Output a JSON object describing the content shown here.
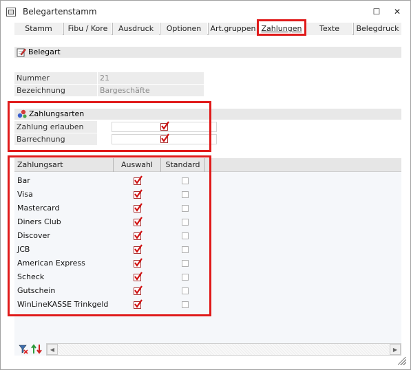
{
  "window": {
    "title": "Belegartenstamm"
  },
  "tabs": [
    {
      "label": "Stamm",
      "active": false
    },
    {
      "label": "Fibu / Kore",
      "active": false
    },
    {
      "label": "Ausdruck",
      "active": false
    },
    {
      "label": "Optionen",
      "active": false
    },
    {
      "label": "Art.gruppen",
      "active": false
    },
    {
      "label": "Zahlungen",
      "active": true
    },
    {
      "label": "Texte",
      "active": false
    },
    {
      "label": "Belegdruck",
      "active": false
    }
  ],
  "belegart": {
    "section_title": "Belegart",
    "nummer_label": "Nummer",
    "nummer_value": "21",
    "bezeichnung_label": "Bezeichnung",
    "bezeichnung_value": "Bargeschäfte"
  },
  "zahlungsarten_section": {
    "title": "Zahlungsarten",
    "erlauben_label": "Zahlung erlauben",
    "erlauben_checked": true,
    "barrechnung_label": "Barrechnung",
    "barrechnung_checked": true
  },
  "grid": {
    "columns": [
      "Zahlungsart",
      "Auswahl",
      "Standard"
    ],
    "rows": [
      {
        "name": "Bar",
        "auswahl": true,
        "standard": false
      },
      {
        "name": "Visa",
        "auswahl": true,
        "standard": false
      },
      {
        "name": "Mastercard",
        "auswahl": true,
        "standard": false
      },
      {
        "name": "Diners Club",
        "auswahl": true,
        "standard": false
      },
      {
        "name": "Discover",
        "auswahl": true,
        "standard": false
      },
      {
        "name": "JCB",
        "auswahl": true,
        "standard": false
      },
      {
        "name": "American Express",
        "auswahl": true,
        "standard": false
      },
      {
        "name": "Scheck",
        "auswahl": true,
        "standard": false
      },
      {
        "name": "Gutschein",
        "auswahl": true,
        "standard": false
      },
      {
        "name": "WinLineKASSE Trinkgeld",
        "auswahl": true,
        "standard": false
      }
    ]
  },
  "colors": {
    "highlight": "#e01a1a",
    "check": "#d01010"
  }
}
